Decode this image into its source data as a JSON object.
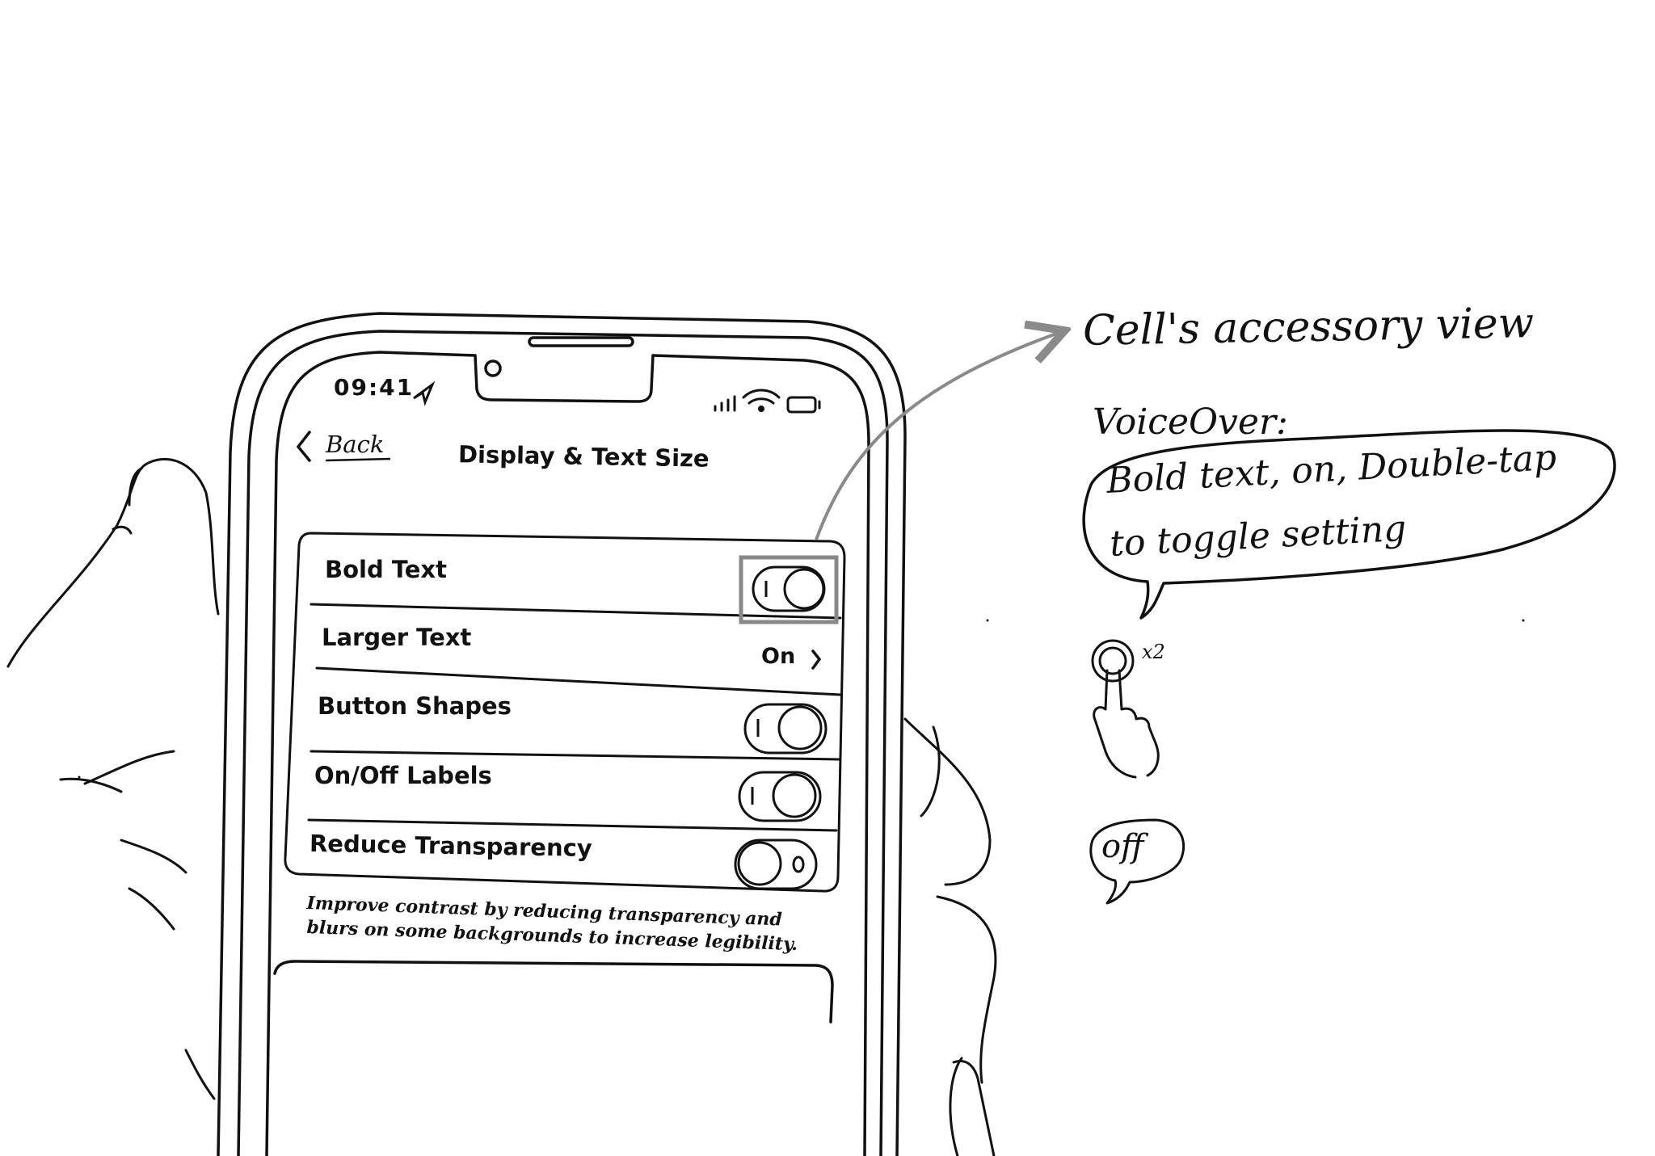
{
  "status_bar": {
    "time": "09:41"
  },
  "nav": {
    "back_label": "Back",
    "title": "Display & Text Size"
  },
  "settings": {
    "rows": [
      {
        "label": "Bold Text",
        "toggle": "on",
        "highlighted": true
      },
      {
        "label": "Larger Text",
        "value": "On"
      },
      {
        "label": "Button Shapes",
        "toggle": "on"
      },
      {
        "label": "On/Off Labels",
        "toggle": "on"
      },
      {
        "label": "Reduce Transparency",
        "toggle": "off"
      }
    ],
    "footer_line1": "Improve contrast by reducing transparency and",
    "footer_line2": "blurs on some backgrounds to increase legibility."
  },
  "annotations": {
    "accessory_label": "Cell's accessory view",
    "voiceover_heading": "VoiceOver:",
    "voiceover_line1": "Bold text, on, Double-tap",
    "voiceover_line2": "to toggle setting",
    "tap_count": "x2",
    "result_bubble": "off"
  },
  "colors": {
    "ink": "#111111",
    "highlight": "#888888",
    "arrow": "#8a8a8a"
  }
}
